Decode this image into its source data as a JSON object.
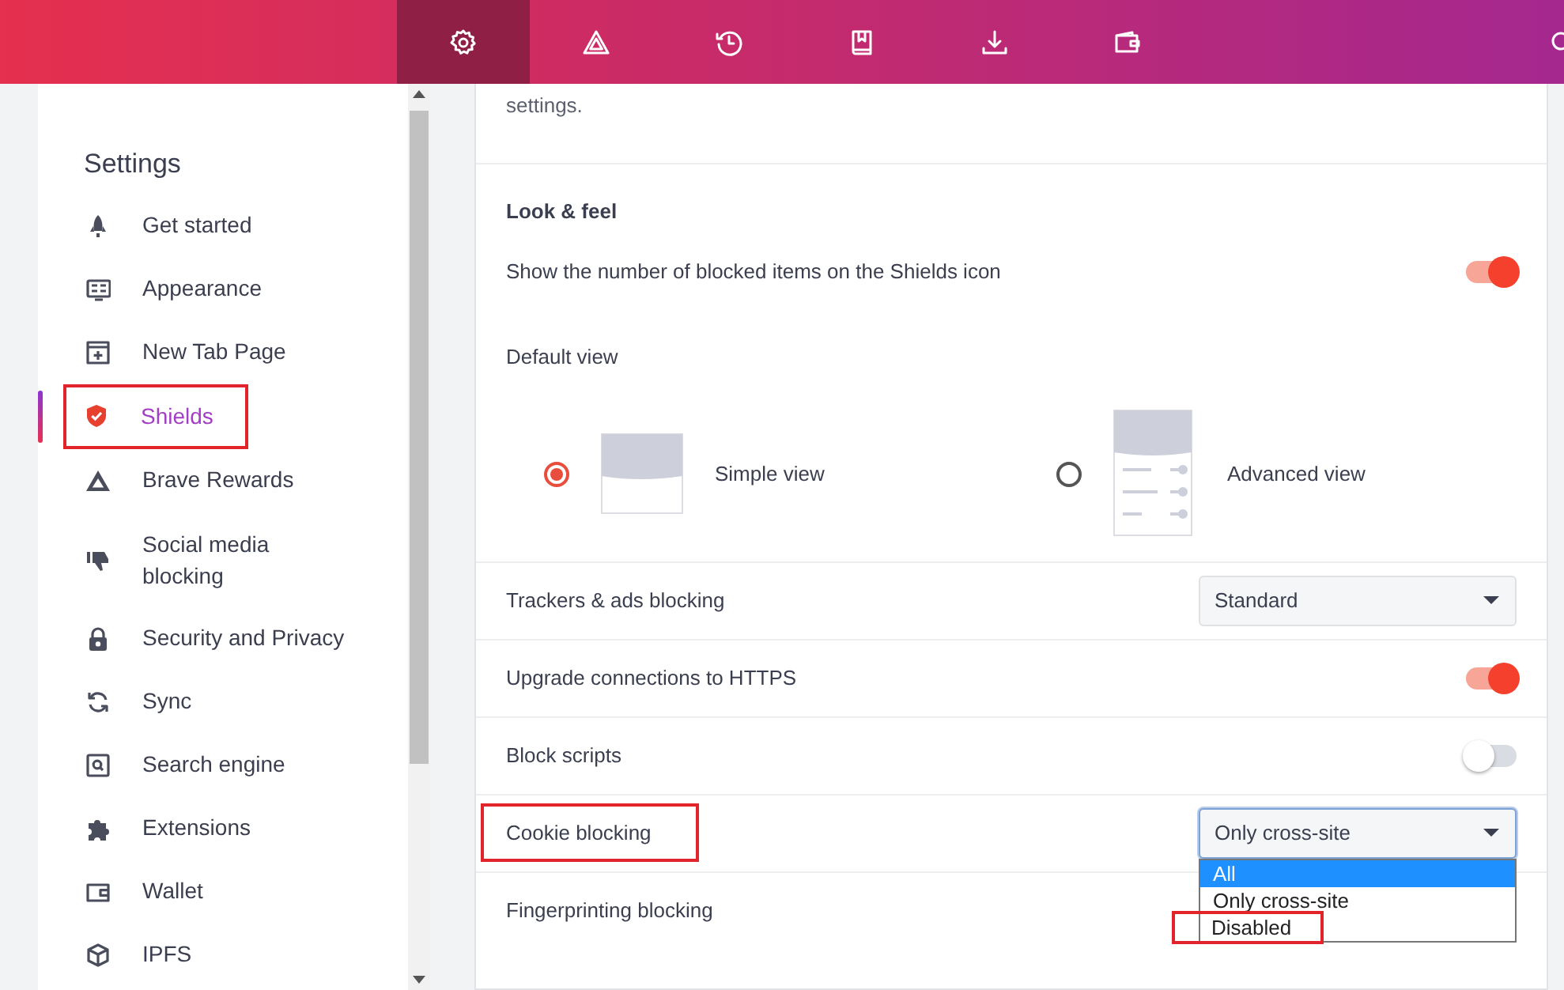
{
  "toolbar": {
    "tabs": [
      {
        "selected": true
      },
      {
        "selected": false
      },
      {
        "selected": false
      },
      {
        "selected": false
      },
      {
        "selected": false
      },
      {
        "selected": false
      },
      {
        "selected": false
      }
    ]
  },
  "sidebar": {
    "title": "Settings",
    "items": [
      {
        "label": "Get started",
        "selected": false,
        "highlighted": false
      },
      {
        "label": "Appearance",
        "selected": false,
        "highlighted": false
      },
      {
        "label": "New Tab Page",
        "selected": false,
        "highlighted": false
      },
      {
        "label": "Shields",
        "selected": true,
        "highlighted": true
      },
      {
        "label": "Brave Rewards",
        "selected": false,
        "highlighted": false
      },
      {
        "label": "Social media blocking",
        "selected": false,
        "highlighted": false
      },
      {
        "label": "Security and Privacy",
        "selected": false,
        "highlighted": false
      },
      {
        "label": "Sync",
        "selected": false,
        "highlighted": false
      },
      {
        "label": "Search engine",
        "selected": false,
        "highlighted": false
      },
      {
        "label": "Extensions",
        "selected": false,
        "highlighted": false
      },
      {
        "label": "Wallet",
        "selected": false,
        "highlighted": false
      },
      {
        "label": "IPFS",
        "selected": false,
        "highlighted": false
      }
    ]
  },
  "content": {
    "intro": "settings.",
    "section_title": "Look & feel",
    "rows": [
      {
        "kind": "toggle",
        "label": "Show the number of blocked items on the Shields icon",
        "on": true,
        "highlighted": false
      },
      {
        "kind": "views",
        "label": "Default view",
        "options": [
          {
            "label": "Simple view",
            "selected": true
          },
          {
            "label": "Advanced view",
            "selected": false
          }
        ]
      },
      {
        "kind": "select",
        "label": "Trackers & ads blocking",
        "value": "Standard",
        "highlighted": false
      },
      {
        "kind": "toggle",
        "label": "Upgrade connections to HTTPS",
        "on": true,
        "highlighted": false
      },
      {
        "kind": "toggle",
        "label": "Block scripts",
        "on": false,
        "highlighted": false
      },
      {
        "kind": "select",
        "label": "Cookie blocking",
        "value": "Only cross-site",
        "highlighted": true,
        "open": true
      },
      {
        "kind": "select",
        "label": "Fingerprinting blocking",
        "highlighted": false
      }
    ]
  },
  "dropdown": {
    "options": [
      {
        "label": "All",
        "selected": true,
        "highlighted": false
      },
      {
        "label": "Only cross-site",
        "selected": false,
        "highlighted": false
      },
      {
        "label": "Disabled",
        "selected": false,
        "highlighted": true
      }
    ]
  }
}
